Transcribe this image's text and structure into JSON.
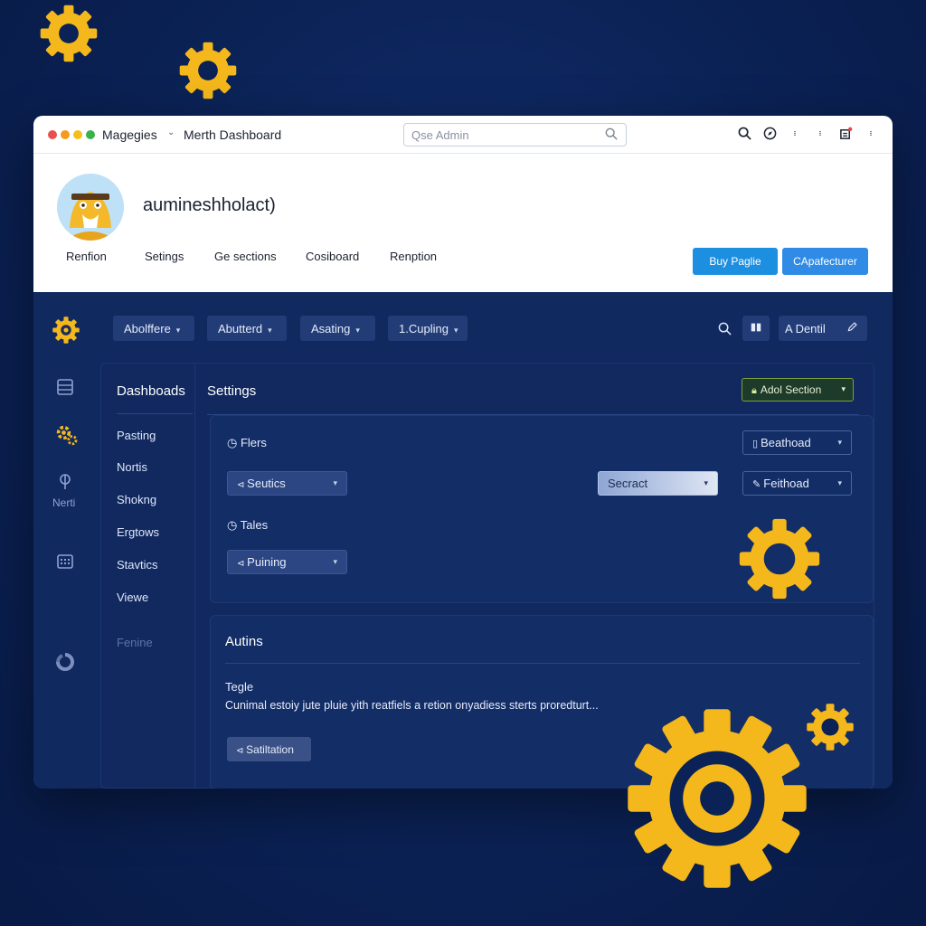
{
  "colors": {
    "background": "#0b2256",
    "gear": "#f5b81c",
    "primary_button": "#1d8fe0",
    "secondary_button": "#2f8be6",
    "dot_red": "#ea4f4f",
    "dot_orange": "#f29b1d",
    "dot_yellow": "#f2c01d",
    "dot_green": "#38b24a"
  },
  "titlebar": {
    "app_name": "Magegies",
    "caret": "⌄",
    "page_title": "Merth Dashboard",
    "search_placeholder": "Qse Admin",
    "icons": [
      "search-icon",
      "compass-icon",
      "more-vertical-icon",
      "more-vertical-icon",
      "notification-icon",
      "more-vertical-icon"
    ]
  },
  "profile": {
    "username": "auminesh​holact)",
    "tabs": [
      "Renfion",
      "Setings",
      "Ge sections",
      "Cosiboard",
      "Renption"
    ],
    "buttons": {
      "primary": "Buy Paglie",
      "secondary": "CApafecturer"
    }
  },
  "toolbar": {
    "dropdowns": [
      "Abolffere",
      "Abutterd",
      "Asating",
      "1.Cupling"
    ],
    "account_label": "A Dentil"
  },
  "sidebar": {
    "icons": [
      "database-icon",
      "gears-icon",
      "key-icon",
      "calendar-icon",
      "recycle-icon"
    ],
    "label": "Nerti"
  },
  "nav": {
    "title": "Dashboads",
    "items": [
      "Pasting",
      "Nortis",
      "Shokng",
      "Ergtows",
      "Stavtics",
      "Viewe",
      "Fenine"
    ]
  },
  "settings": {
    "title": "Settings",
    "add_section": "Adol Section",
    "flers_label": "Flers",
    "sections_select": "Seutics",
    "secract_select": "Secract",
    "beathood_select": "Beathoad",
    "feithood_select": "Feithoad",
    "tales_label": "Tales",
    "puining_select": "Puining"
  },
  "autins": {
    "title": "Autins",
    "field_label": "Tegle",
    "description": "Cunimal estoiy jute pluie yith reatfiels a retion onyadiess sterts proredturt...",
    "button": "Satiltation"
  }
}
